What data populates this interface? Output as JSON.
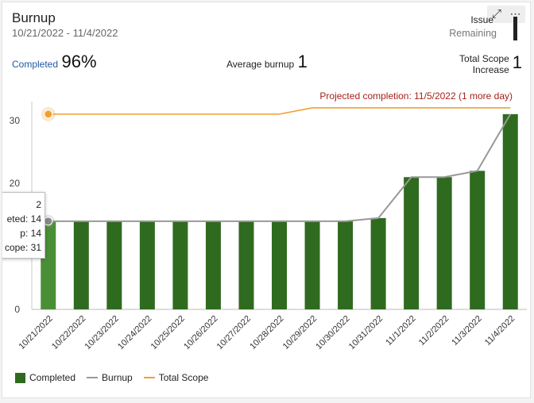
{
  "header": {
    "title": "Burnup",
    "date_range": "10/21/2022 - 11/4/2022",
    "issue_label": "Issue",
    "remaining_label": "Remaining"
  },
  "stats": {
    "completed_label": "Completed",
    "completed_value": "96%",
    "avg_burnup_label": "Average burnup",
    "avg_burnup_value": "1",
    "scope_increase_label_line1": "Total Scope",
    "scope_increase_label_line2": "Increase",
    "scope_increase_value": "1"
  },
  "projected": "Projected completion: 11/5/2022 (1 more day)",
  "tooltip": {
    "line1": "2",
    "line2": "eted: 14",
    "line3": "p: 14",
    "line4": "cope: 31"
  },
  "legend": {
    "completed": "Completed",
    "burnup": "Burnup",
    "total_scope": "Total Scope"
  },
  "colors": {
    "completed": "#2f6b1f",
    "completed_highlight": "#4a8f35",
    "burnup": "#999999",
    "total_scope": "#f0a030"
  },
  "chart_data": {
    "type": "bar",
    "categories": [
      "10/21/2022",
      "10/22/2022",
      "10/23/2022",
      "10/24/2022",
      "10/25/2022",
      "10/26/2022",
      "10/27/2022",
      "10/28/2022",
      "10/29/2022",
      "10/30/2022",
      "10/31/2022",
      "11/1/2022",
      "11/2/2022",
      "11/3/2022",
      "11/4/2022"
    ],
    "series": [
      {
        "name": "Completed",
        "kind": "bar",
        "values": [
          14,
          14,
          14,
          14,
          14,
          14,
          14,
          14,
          14,
          14,
          14.5,
          21,
          21,
          22,
          31
        ]
      },
      {
        "name": "Burnup",
        "kind": "line",
        "values": [
          14,
          14,
          14,
          14,
          14,
          14,
          14,
          14,
          14,
          14,
          14.5,
          21,
          21,
          22,
          31
        ]
      },
      {
        "name": "Total Scope",
        "kind": "line",
        "values": [
          31,
          31,
          31,
          31,
          31,
          31,
          31,
          31,
          32,
          32,
          32,
          32,
          32,
          32,
          32
        ]
      }
    ],
    "yticks": [
      0,
      10,
      20,
      30
    ],
    "ylim": [
      0,
      33
    ],
    "legend_position": "bottom-left",
    "grid": false
  }
}
